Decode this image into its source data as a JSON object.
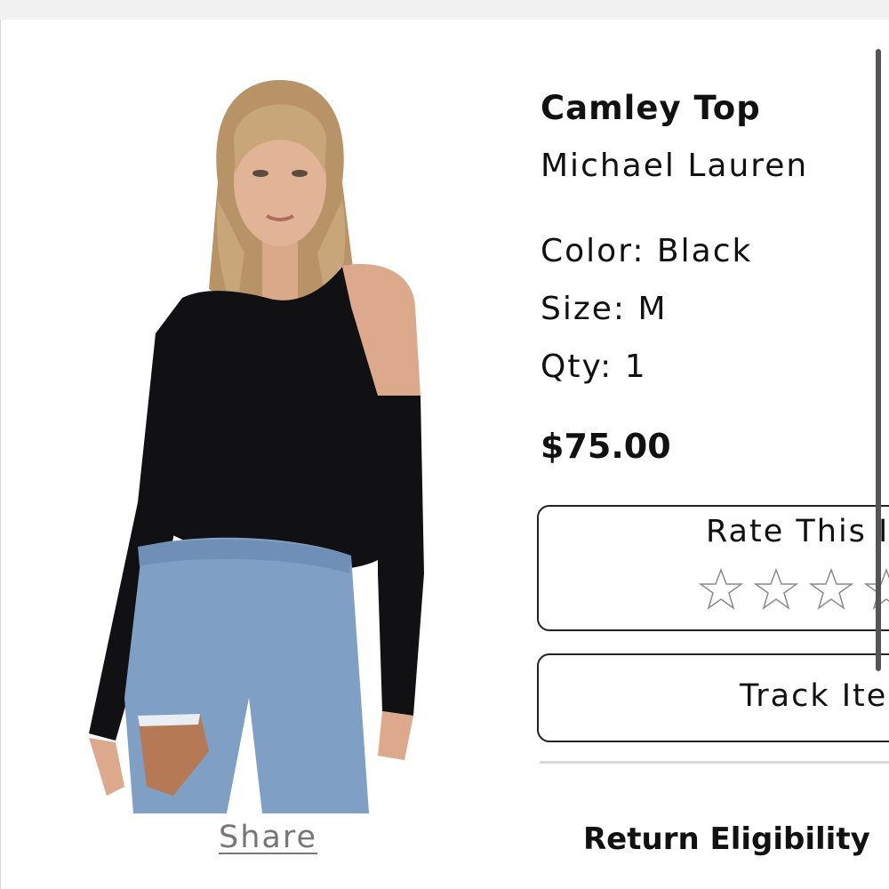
{
  "product": {
    "name": "Camley Top",
    "brand": "Michael Lauren",
    "color": "Color: Black",
    "size": "Size: M",
    "qty": "Qty: 1",
    "price": "$75.00"
  },
  "rating": {
    "label": "Rate This I",
    "stars_total": 5,
    "stars_filled": 0,
    "star_icon": "star-outline-icon"
  },
  "actions": {
    "track_label": "Track Ite",
    "share_label": "Share"
  },
  "returns": {
    "heading": "Return Eligibility"
  },
  "colors": {
    "text": "#111111",
    "muted": "#777777",
    "border": "#222222",
    "top_bar": "#f1f1f1"
  }
}
